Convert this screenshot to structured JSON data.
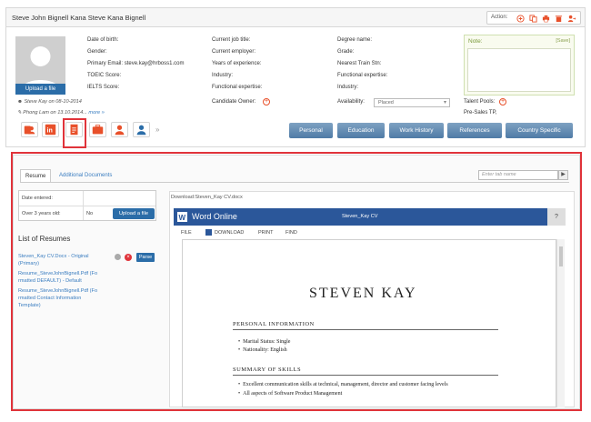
{
  "header": {
    "title": "Steve John Bignell Kana Steve Kana Bignell",
    "action_label": "Action:"
  },
  "profile": {
    "upload_photo_label": "Upload a file",
    "fields_col1": [
      "Date of birth:",
      "Gender:",
      "Primary Email:",
      "TOEIC Score:",
      "IELTS Score:"
    ],
    "email": "steve.kay@hrboss1.com",
    "fields_col2": [
      "Current job title:",
      "Current employer:",
      "Years of experience:",
      "Industry:",
      "Functional expertise:"
    ],
    "fields_col3": [
      "Degree name:",
      "Grade:",
      "Nearest Train Stn:",
      "Functional expertise:",
      "Industry:"
    ],
    "created_by": "Steve Kay on 08-10-2014",
    "edited_by": "Phong Lam on 13.10.2014...",
    "more_link": "more »",
    "candidate_owner_label": "Candidate Owner:",
    "availability_label": "Availability:",
    "availability_value": "Placed",
    "talent_pools_label": "Talent Pools:",
    "talent_pools_value": "Pre-Sales TP,",
    "note_label": "Note:",
    "note_save": "[Save]"
  },
  "nav_tabs": [
    "Personal",
    "Education",
    "Work History",
    "References",
    "Country Specific"
  ],
  "resume_section": {
    "tabs": [
      "Resume",
      "Additional Documents"
    ],
    "tab_search_placeholder": "Enter tab name",
    "tab_go": "▶",
    "date_entered_label": "Date entered:",
    "over3_label": "Over 3 years old:",
    "over3_value": "No",
    "upload_label": "Upload a file",
    "list_title": "List of Resumes",
    "resumes": [
      [
        "Steven_Kay CV.Docx - Original",
        "(Primary)"
      ],
      [
        "Resume_SteveJohnBignell.Pdf (Fo",
        "rmatted DEFAULT) - Default"
      ],
      [
        "Resume_SteveJohnBignell.Pdf (Fo",
        "rmatted Contact Information",
        "Template)"
      ]
    ],
    "parse_label": "Parse"
  },
  "viewer": {
    "download_label": "Download:Steven_Kay CV.docx",
    "app_name": "Word Online",
    "doc_title": "Steven_Kay CV",
    "help": "?",
    "menu": [
      "FILE",
      "DOWNLOAD",
      "PRINT",
      "FIND"
    ],
    "cv_name": "STEVEN KAY",
    "section1": "PERSONAL INFORMATION",
    "personal": [
      "Marital Status:  Single",
      "Nationality:     English"
    ],
    "section2": "SUMMARY OF SKILLS",
    "skills": [
      "Excellent communication skills at technical, management, director and customer facing levels",
      "All aspects of Software Product Management"
    ]
  },
  "colors": {
    "accent": "#e8502a",
    "nav_blue": "#4f7ba6",
    "word_blue": "#2b579a",
    "highlight": "#e0333a"
  }
}
